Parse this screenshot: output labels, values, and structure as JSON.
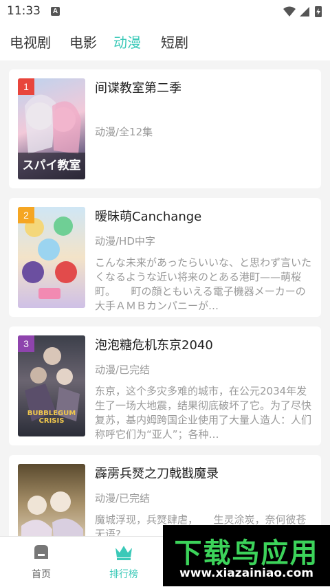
{
  "status": {
    "time": "11:33",
    "a_label": "A"
  },
  "tabs": [
    {
      "label": "电视剧",
      "active": false
    },
    {
      "label": "电影",
      "active": false
    },
    {
      "label": "动漫",
      "active": true
    },
    {
      "label": "短剧",
      "active": false
    }
  ],
  "accent_color": "#3bc9b8",
  "items": [
    {
      "rank": "1",
      "rank_color": "#e8453c",
      "title": "间谍教室第二季",
      "meta": "动漫/全12集",
      "desc": "",
      "cover_text": "スパイ教室"
    },
    {
      "rank": "2",
      "rank_color": "#f5a623",
      "title": "暧昧萌Canchange",
      "meta": "动漫/HD中字",
      "desc": "こんな未来があったらいいな、と思わず言いたくなるような近い将来のとある港町——萌桜町。　　町の顔ともいえる電子機器メーカーの大手ＡＭＢカンパニーが…",
      "cover_text": ""
    },
    {
      "rank": "3",
      "rank_color": "#8e44ad",
      "title": "泡泡糖危机东京2040",
      "meta": "动漫/已完结",
      "desc": "东京，这个多灾多难的城市，在公元2034年发生了一场大地震，结果彻底破坏了它。为了尽快复苏，基内姆跨国企业使用了大量人造人：人们称呼它们为“亚人”；各种…",
      "cover_text": "BUBBLEGUM CRISIS"
    },
    {
      "rank": "",
      "rank_color": "",
      "title": "霹雳兵燹之刀戟戡魔录",
      "meta": "动漫/已完结",
      "desc": "魔城浮现，兵燹肆虐，　　生灵涂炭，奈何彼苍无语?",
      "cover_text": ""
    }
  ],
  "bottom_nav": [
    {
      "label": "首页",
      "icon": "home-icon"
    },
    {
      "label": "排行榜",
      "icon": "crown-icon"
    }
  ],
  "watermark": {
    "text": "下载鸟应用",
    "url": "www.xiazainiao.com"
  }
}
